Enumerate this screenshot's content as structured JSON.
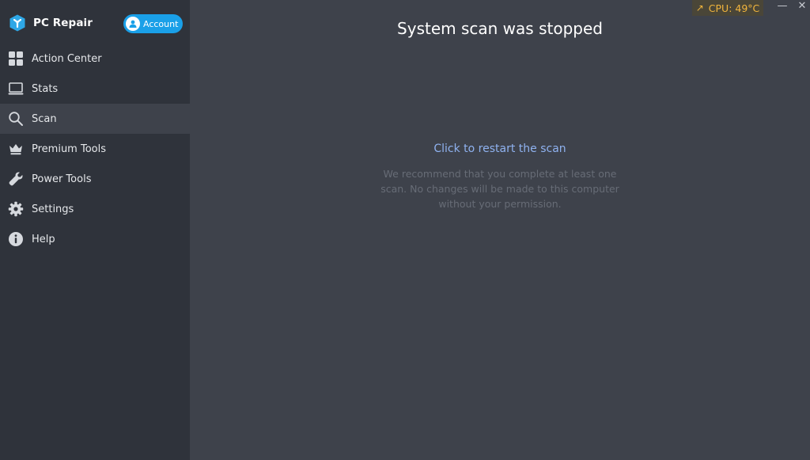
{
  "app": {
    "name": "PC Repair",
    "account_label": "Account"
  },
  "sidebar": {
    "items": [
      {
        "label": "Action Center",
        "icon": "grid-icon",
        "active": false
      },
      {
        "label": "Stats",
        "icon": "laptop-icon",
        "active": false
      },
      {
        "label": "Scan",
        "icon": "search-icon",
        "active": true
      },
      {
        "label": "Premium Tools",
        "icon": "crown-icon",
        "active": false
      },
      {
        "label": "Power Tools",
        "icon": "wrench-icon",
        "active": false
      },
      {
        "label": "Settings",
        "icon": "gear-icon",
        "active": false
      },
      {
        "label": "Help",
        "icon": "info-icon",
        "active": false
      }
    ]
  },
  "main": {
    "title": "System scan was stopped",
    "restart_link": "Click to restart the scan",
    "recommend_text": "We recommend that you complete at least one scan. No changes will be made to this computer without your permission."
  },
  "status": {
    "cpu_text": "CPU: 49°C"
  },
  "window": {
    "minimize": "—",
    "close": "✕"
  },
  "colors": {
    "sidebar_bg": "#2f333b",
    "main_bg": "#3e424b",
    "accent_blue": "#1aa0e8",
    "link": "#8fb2f0",
    "cpu_warning": "#f2b53c"
  }
}
